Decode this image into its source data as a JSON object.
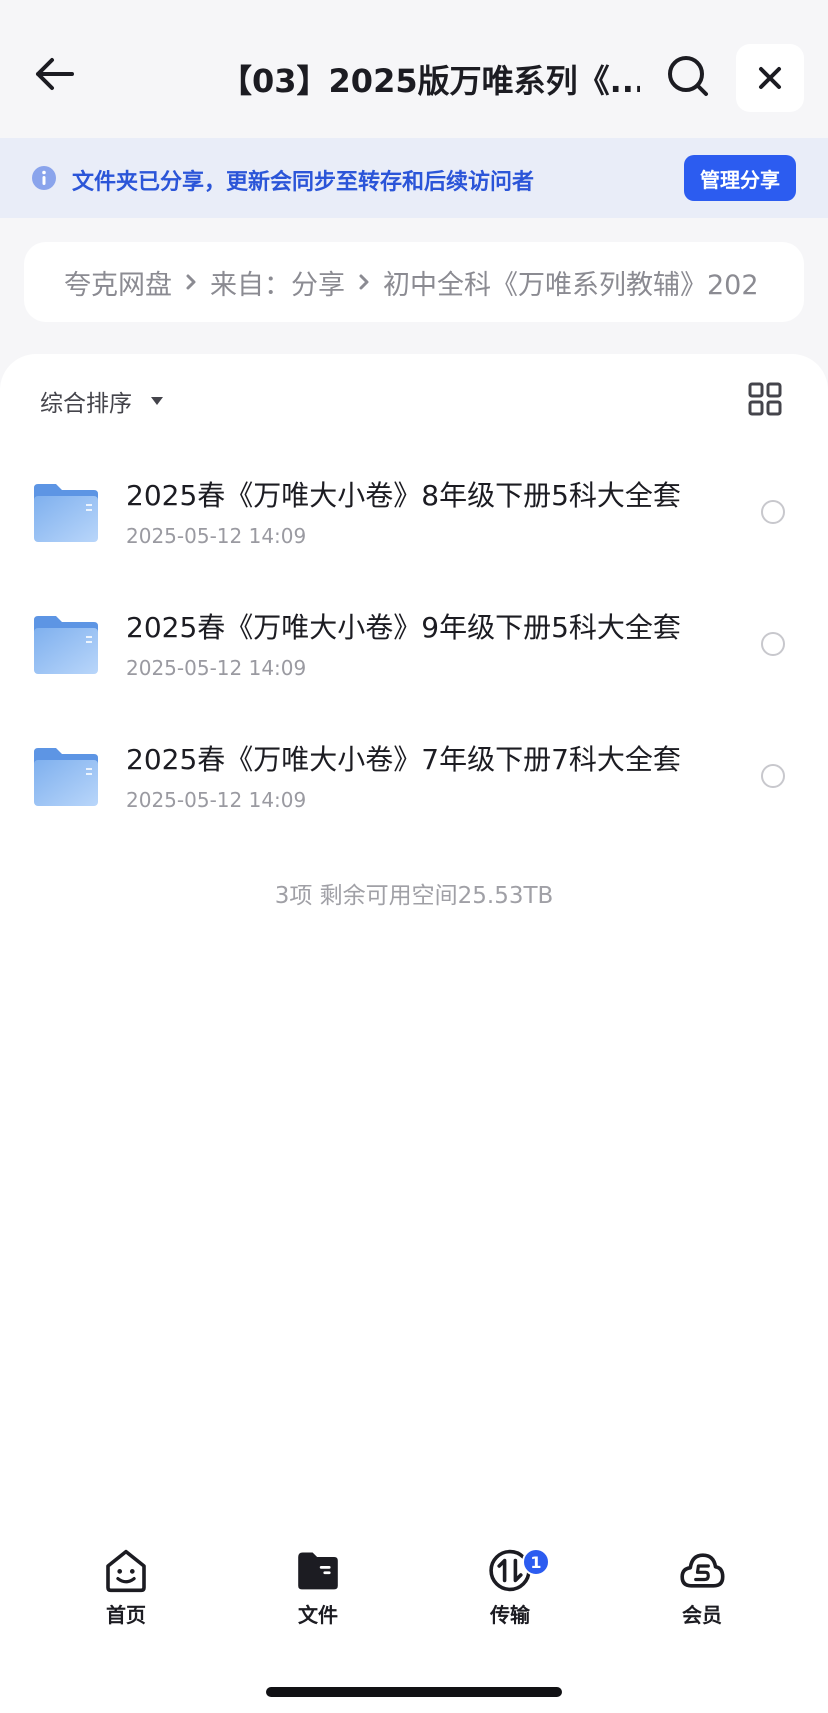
{
  "header": {
    "title": "【03】2025版万唯系列《...",
    "back_icon": "arrow-left-icon",
    "search_icon": "search-icon",
    "close_icon": "close-icon"
  },
  "banner": {
    "text": "文件夹已分享，更新会同步至转存和后续访问者",
    "button_label": "管理分享",
    "accent": "#2c5cf0"
  },
  "breadcrumb": {
    "items": [
      "夸克网盘",
      "来自：分享",
      "初中全科《万唯系列教辅》202"
    ]
  },
  "toolbar": {
    "sort_label": "综合排序",
    "view_icon": "grid-view-icon"
  },
  "files": [
    {
      "name": "2025春《万唯大小卷》8年级下册5科大全套",
      "date": "2025-05-12 14:09"
    },
    {
      "name": "2025春《万唯大小卷》9年级下册5科大全套",
      "date": "2025-05-12 14:09"
    },
    {
      "name": "2025春《万唯大小卷》7年级下册7科大全套",
      "date": "2025-05-12 14:09"
    }
  ],
  "summary": "3项 剩余可用空间25.53TB",
  "tabs": [
    {
      "label": "首页",
      "icon": "home-smile-icon"
    },
    {
      "label": "文件",
      "icon": "folder-icon"
    },
    {
      "label": "传输",
      "icon": "transfer-icon",
      "badge": "1"
    },
    {
      "label": "会员",
      "icon": "cloud-vip-icon"
    }
  ]
}
